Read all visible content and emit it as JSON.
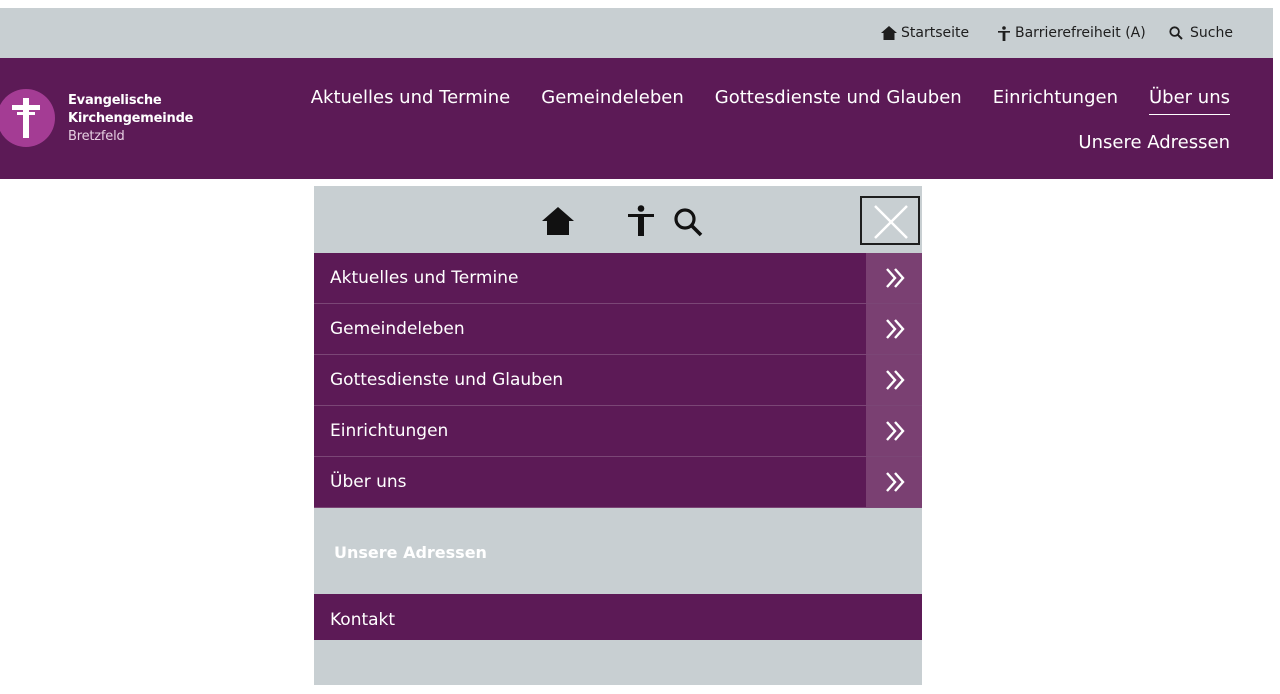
{
  "utility_bar": {
    "home_label": "Startseite",
    "accessibility_label": "Barrierefreiheit (A)",
    "search_label": "Suche"
  },
  "header": {
    "logo_line1": "Evangelische",
    "logo_line2": "Kirchengemeinde",
    "logo_line3": "Bretzfeld",
    "nav": [
      "Aktuelles und Termine",
      "Gemeindeleben",
      "Gottesdienste und Glauben",
      "Einrichtungen",
      "Über uns"
    ],
    "active_nav": "Über uns",
    "subnav": "Unsere Adressen"
  },
  "mobile_menu": {
    "items": [
      "Aktuelles und Termine",
      "Gemeindeleben",
      "Gottesdienste und Glauben",
      "Einrichtungen",
      "Über uns"
    ],
    "sub_item": "Unsere Adressen",
    "kontakt": "Kontakt"
  },
  "colors": {
    "brand_purple": "#5c1a56",
    "arrow_bg": "#7a4072",
    "logo_pink": "#a43c94",
    "gray_bar": "#c8cfd2"
  },
  "icons": {
    "home": "home-icon",
    "accessibility": "accessibility-icon",
    "search": "search-icon",
    "close": "close-icon",
    "chevron": "double-chevron-right-icon",
    "logo": "cross-logo-icon"
  }
}
